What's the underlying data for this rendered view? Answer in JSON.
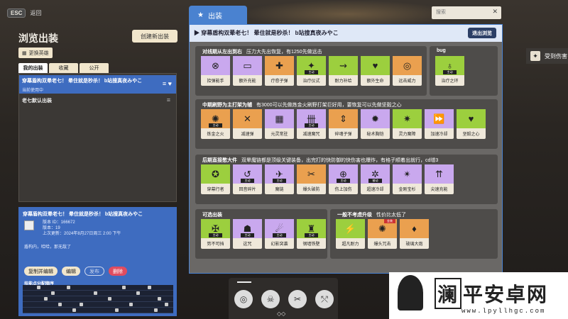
{
  "top": {
    "esc_key": "ESC",
    "back": "返回"
  },
  "left": {
    "title": "浏览出装",
    "create_button": "创建新出装",
    "switch_hero": "更换英雄",
    "tabs": [
      "我的出装",
      "收藏",
      "公开"
    ],
    "selected_item": {
      "title": "穿幕盾构双晕老七！ 晕住就是秒杀！ b站搜真夜みやこ",
      "sub": "当前使用中"
    },
    "item2": {
      "title": "老七默认出装"
    }
  },
  "detail": {
    "title": "穿幕盾构双晕老七！ 晕住就是秒杀！ b站搜真夜みやこ",
    "version_id": "版本 ID：166672",
    "version": "版本：19",
    "updated": "上次更新：2024年8月27日周三 2:00 下午",
    "desc": "盾构内，哈哈，那无敌了",
    "buttons": {
      "copy_edit": "复制并编辑",
      "edit": "编辑",
      "publish": "发布",
      "delete": "删除"
    },
    "order_label": "技能点分配顺序"
  },
  "main": {
    "tab": "出装",
    "search_placeholder": "搜索",
    "header": "穿幕盾构双晕老七！ 晕住就是秒杀！ b站搜真夜みやこ",
    "exit": "退出浏览",
    "sections": [
      {
        "title": "对线期从左出到右",
        "note": "压力大先出恢复，有1250先做远击",
        "cards": [
          {
            "name": "拾弹能手",
            "color": "purple",
            "icon": "⊗"
          },
          {
            "name": "额外充能",
            "color": "purple",
            "icon": "▭"
          },
          {
            "name": "疗愈子弹",
            "color": "orange",
            "icon": "✚"
          },
          {
            "name": "治疗仪式",
            "color": "green",
            "icon": "✦",
            "badge": "主动"
          },
          {
            "name": "耐力补给",
            "color": "green",
            "icon": "⇝"
          },
          {
            "name": "额外生命",
            "color": "green",
            "icon": "♥"
          },
          {
            "name": "远击威力",
            "color": "orange",
            "icon": "◎"
          }
        ]
      },
      {
        "title": "bug",
        "note": "",
        "cards": [
          {
            "name": "治疗之环",
            "color": "green",
            "icon": "♁",
            "badge": "主动"
          }
        ]
      },
      {
        "title": "中期刷野为主打架为辅",
        "note": "有3000可以先做炼金火刷野打架巨好用，要恢复可以先做坚毅之心",
        "cards": [
          {
            "name": "炼金之火",
            "color": "orange",
            "icon": "✺",
            "badge": "主动"
          },
          {
            "name": "减速弹",
            "color": "orange",
            "icon": "✕"
          },
          {
            "name": "元灵常驻",
            "color": "purple",
            "icon": "▦"
          },
          {
            "name": "减速魔咒",
            "color": "purple",
            "icon": "卌",
            "badge": "主动"
          },
          {
            "name": "碎魂子弹",
            "color": "orange",
            "icon": "⇕"
          },
          {
            "name": "秘术胸铠",
            "color": "purple",
            "icon": "✹"
          },
          {
            "name": "灵力魔障",
            "color": "green",
            "icon": "✷"
          },
          {
            "name": "加速冷却",
            "color": "purple",
            "icon": "⏩"
          },
          {
            "name": "坚毅之心",
            "color": "green",
            "icon": "♥"
          }
        ]
      },
      {
        "title": "后期直接憋大件",
        "note": "双晕魔链都是顶级关键装备，出完打的快防御的快伤害也爆炸，有格子顺着出就行，cd增3",
        "cards": [
          {
            "name": "穿幕行者",
            "color": "green",
            "icon": "✪"
          },
          {
            "name": "回音碎片",
            "color": "purple",
            "icon": "↺",
            "badge": "主动"
          },
          {
            "name": "魔链",
            "color": "purple",
            "icon": "✈",
            "badge": "主动"
          },
          {
            "name": "爆头破防",
            "color": "orange",
            "icon": "✂"
          },
          {
            "name": "伤上加伤",
            "color": "purple",
            "icon": "⊕",
            "badge": "主动"
          },
          {
            "name": "超速冷却",
            "color": "purple",
            "icon": "✲",
            "badge": "被动"
          },
          {
            "name": "金刚宝杉",
            "color": "purple",
            "icon": "✴"
          },
          {
            "name": "尖速充能",
            "color": "purple",
            "icon": "⇈"
          }
        ]
      },
      {
        "title": "可选出装",
        "note": "",
        "cards": [
          {
            "name": "势不可挡",
            "color": "green",
            "icon": "✠",
            "badge": "主动"
          },
          {
            "name": "这咒",
            "color": "purple",
            "icon": "☗",
            "badge": "主动"
          },
          {
            "name": "幻影突袭",
            "color": "purple",
            "icon": "☄",
            "badge": "主动"
          },
          {
            "name": "钢墙铁壁",
            "color": "green",
            "icon": "♜",
            "badge": "主动"
          }
        ]
      },
      {
        "title": "一般不考虑升级",
        "note": "性价比太低了",
        "cards": [
          {
            "name": "超凡耐力",
            "color": "green",
            "icon": "⚡"
          },
          {
            "name": "爆头冗击",
            "color": "orange",
            "icon": "✺",
            "tag": "金装"
          },
          {
            "name": "玻璃大炮",
            "color": "orange",
            "icon": "♦"
          }
        ]
      }
    ]
  },
  "right": {
    "hurt_label": "受到伤害"
  },
  "watermark": {
    "cn": [
      "澜",
      "平安卓网"
    ],
    "url": "www.lpyllhgc.com"
  }
}
